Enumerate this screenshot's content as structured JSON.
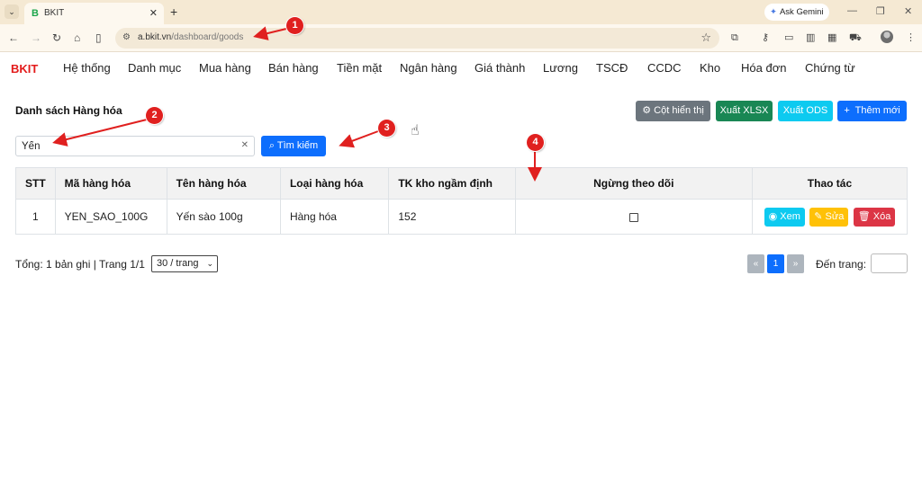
{
  "browser": {
    "tab_title": "BKIT",
    "tab_favicon": "B",
    "url_host": "a.bkit.vn",
    "url_path": "/dashboard/goods",
    "gemini_label": "Ask Gemini"
  },
  "app": {
    "brand": "BKIT",
    "menu": [
      "Hệ thống",
      "Danh mục",
      "Mua hàng",
      "Bán hàng",
      "Tiền mặt",
      "Ngân hàng",
      "Giá thành",
      "Lương",
      "TSCĐ",
      "CCDC",
      "Kho",
      "Hóa đơn",
      "Chứng từ"
    ]
  },
  "page": {
    "title": "Danh sách Hàng hóa",
    "buttons": {
      "columns": "Cột hiển thị",
      "export_xlsx": "Xuất XLSX",
      "export_ods": "Xuất ODS",
      "add_new": "Thêm mới"
    },
    "search": {
      "value": "Yến",
      "button": "Tìm kiếm"
    }
  },
  "table": {
    "headers": [
      "STT",
      "Mã hàng hóa",
      "Tên hàng hóa",
      "Loại hàng hóa",
      "TK kho ngầm định",
      "Ngừng theo dõi",
      "Thao tác"
    ],
    "rows": [
      {
        "stt": "1",
        "code": "YEN_SAO_100G",
        "name": "Yến sào 100g",
        "type": "Hàng hóa",
        "account": "152",
        "inactive": false
      }
    ],
    "actions": {
      "view": "Xem",
      "edit": "Sửa",
      "delete": "Xóa"
    }
  },
  "footer": {
    "summary": "Tổng: 1 bản ghi | Trang 1/1",
    "page_size": "30 / trang",
    "prev": "«",
    "current_page": "1",
    "next": "»",
    "goto_label": "Đến trang:"
  },
  "annotations": [
    "1",
    "2",
    "3",
    "4"
  ],
  "colors": {
    "brand": "#e31b1b",
    "primary": "#0d6efd",
    "success": "#198754",
    "info": "#0dcaf0",
    "warning": "#ffc107",
    "danger": "#dc3545",
    "secondary": "#6c757d",
    "annotation": "#e0201f"
  }
}
